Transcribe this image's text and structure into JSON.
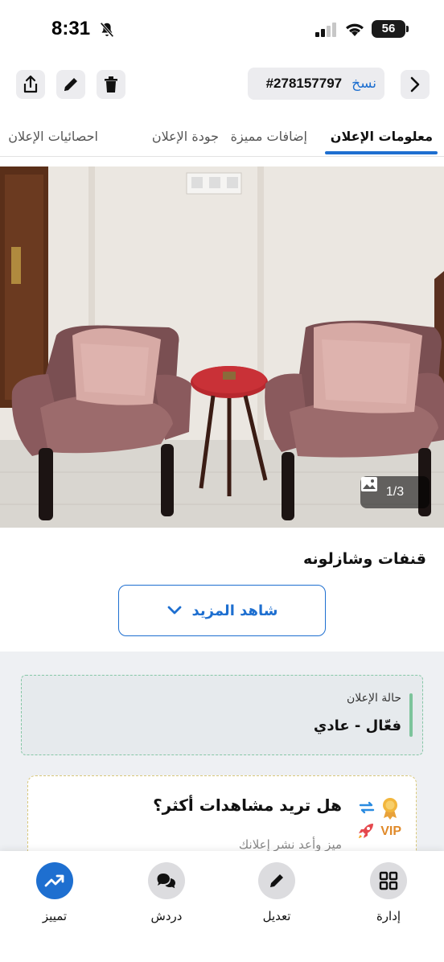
{
  "status_bar": {
    "time": "8:31",
    "battery": "56"
  },
  "header": {
    "copy_label": "نسخ",
    "ad_id": "#278157797"
  },
  "tabs": [
    {
      "label": "معلومات الإعلان"
    },
    {
      "label": "إضافات مميزة"
    },
    {
      "label": "جودة الإعلان"
    },
    {
      "label": "احصائيات الإعلان"
    }
  ],
  "photo": {
    "counter": "1/3"
  },
  "ad": {
    "title": "قنفات وشازلونه",
    "see_more": "شاهد المزيد"
  },
  "status_card": {
    "label": "حالة الإعلان",
    "value": "فعّال - عادي"
  },
  "promo": {
    "title": "هل تريد مشاهدات أكثر؟",
    "subtitle": "ميز وأعد نشر إعلانك",
    "vip": "VIP"
  },
  "bottom_nav": [
    {
      "label": "إدارة",
      "icon": "grid-icon"
    },
    {
      "label": "تعديل",
      "icon": "pencil-icon"
    },
    {
      "label": "دردش",
      "icon": "chat-icon"
    },
    {
      "label": "تمييز",
      "icon": "trending-up-icon"
    }
  ],
  "colors": {
    "accent": "#1e6fd0",
    "status_green": "#7cc49b",
    "vip": "#e08a2a"
  }
}
